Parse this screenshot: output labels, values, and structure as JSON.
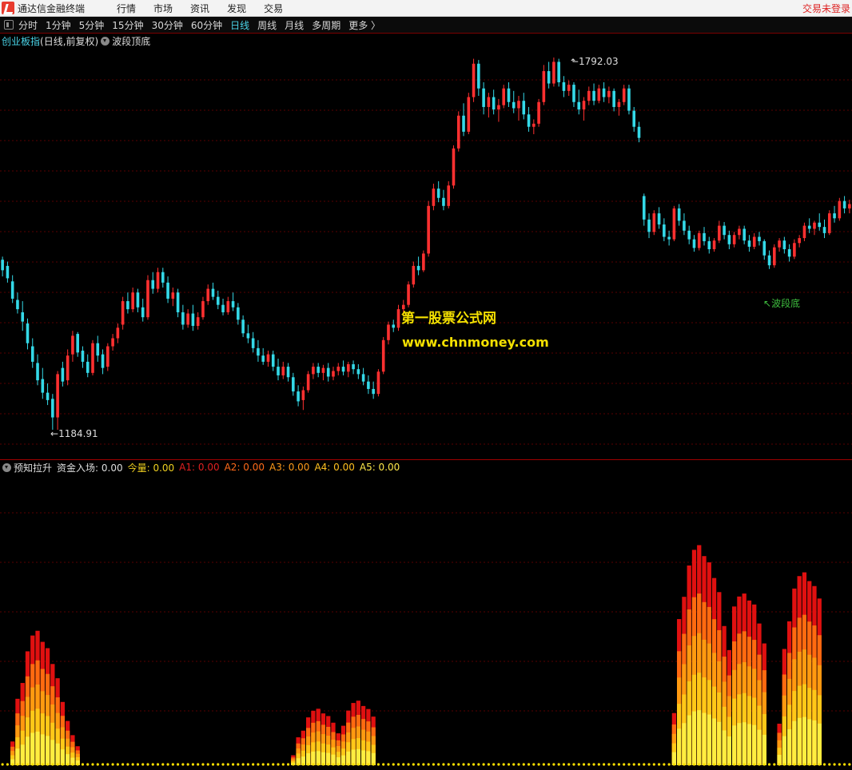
{
  "menubar": {
    "app_name": "通达信金融终端",
    "menus": [
      "行情",
      "市场",
      "资讯",
      "发现",
      "交易"
    ],
    "status": "交易未登录"
  },
  "toolbar": {
    "periods": [
      "分时",
      "1分钟",
      "5分钟",
      "15分钟",
      "30分钟",
      "60分钟",
      "日线",
      "周线",
      "月线",
      "多周期",
      "更多 〉"
    ],
    "active_period": "日线"
  },
  "main_chart": {
    "title": "创业板指",
    "title_suffix": "(日线,前复权)",
    "indicator": "波段顶底",
    "high_label": "1792.03",
    "low_label": "1184.91",
    "bottom_marker": "波段底",
    "bottom_marker_color": "#3fbf3f"
  },
  "sub_chart": {
    "indicator": "预知拉升",
    "fields": [
      {
        "label": "资金入场:",
        "value": "0.00",
        "color": "#dddddd"
      },
      {
        "label": "今量:",
        "value": "0.00",
        "color": "#f0d020"
      },
      {
        "label": "A1:",
        "value": "0.00",
        "color": "#e02020"
      },
      {
        "label": "A2:",
        "value": "0.00",
        "color": "#ff6a1a"
      },
      {
        "label": "A3:",
        "value": "0.00",
        "color": "#ff9a1a"
      },
      {
        "label": "A4:",
        "value": "0.00",
        "color": "#ffc020"
      },
      {
        "label": "A5:",
        "value": "0.00",
        "color": "#ffe84a"
      }
    ]
  },
  "watermark": {
    "line1": "第一股票公式网",
    "line2": "www.chnmoney.com"
  },
  "colors": {
    "up": "#ff3030",
    "down": "#34d9e8",
    "grid": "#5a0000",
    "bars": [
      "#e01010",
      "#ff6a10",
      "#ff9a10",
      "#ffc818",
      "#ffee40"
    ]
  },
  "chart_data": {
    "type": "candlestick",
    "title": "创业板指",
    "price_range": [
      1184.91,
      1792.03
    ],
    "ohlc": [
      [
        1465,
        1470,
        1438,
        1448
      ],
      [
        1455,
        1462,
        1428,
        1435
      ],
      [
        1430,
        1440,
        1395,
        1402
      ],
      [
        1400,
        1412,
        1378,
        1385
      ],
      [
        1380,
        1398,
        1350,
        1365
      ],
      [
        1362,
        1370,
        1320,
        1330
      ],
      [
        1325,
        1338,
        1290,
        1300
      ],
      [
        1298,
        1312,
        1262,
        1270
      ],
      [
        1272,
        1290,
        1240,
        1250
      ],
      [
        1250,
        1265,
        1230,
        1238
      ],
      [
        1240,
        1248,
        1190,
        1210
      ],
      [
        1210,
        1285,
        1190,
        1280
      ],
      [
        1290,
        1300,
        1260,
        1268
      ],
      [
        1270,
        1320,
        1262,
        1310
      ],
      [
        1312,
        1350,
        1300,
        1342
      ],
      [
        1345,
        1348,
        1308,
        1315
      ],
      [
        1318,
        1325,
        1290,
        1300
      ],
      [
        1300,
        1312,
        1275,
        1282
      ],
      [
        1282,
        1335,
        1278,
        1330
      ],
      [
        1330,
        1342,
        1300,
        1310
      ],
      [
        1312,
        1320,
        1280,
        1290
      ],
      [
        1292,
        1330,
        1285,
        1325
      ],
      [
        1325,
        1345,
        1318,
        1338
      ],
      [
        1338,
        1362,
        1330,
        1355
      ],
      [
        1360,
        1405,
        1352,
        1398
      ],
      [
        1398,
        1412,
        1378,
        1385
      ],
      [
        1385,
        1420,
        1380,
        1412
      ],
      [
        1412,
        1418,
        1380,
        1388
      ],
      [
        1388,
        1402,
        1365,
        1372
      ],
      [
        1372,
        1440,
        1368,
        1432
      ],
      [
        1432,
        1445,
        1410,
        1418
      ],
      [
        1418,
        1452,
        1412,
        1445
      ],
      [
        1445,
        1452,
        1420,
        1428
      ],
      [
        1428,
        1438,
        1395,
        1402
      ],
      [
        1402,
        1420,
        1390,
        1412
      ],
      [
        1412,
        1418,
        1372,
        1380
      ],
      [
        1380,
        1392,
        1352,
        1360
      ],
      [
        1360,
        1385,
        1355,
        1378
      ],
      [
        1378,
        1392,
        1350,
        1358
      ],
      [
        1358,
        1380,
        1352,
        1372
      ],
      [
        1372,
        1405,
        1368,
        1398
      ],
      [
        1398,
        1425,
        1392,
        1418
      ],
      [
        1418,
        1428,
        1400,
        1405
      ],
      [
        1405,
        1415,
        1385,
        1392
      ],
      [
        1392,
        1402,
        1375,
        1380
      ],
      [
        1380,
        1405,
        1376,
        1398
      ],
      [
        1398,
        1412,
        1382,
        1388
      ],
      [
        1388,
        1395,
        1360,
        1368
      ],
      [
        1368,
        1375,
        1340,
        1346
      ],
      [
        1346,
        1360,
        1330,
        1338
      ],
      [
        1338,
        1348,
        1315,
        1322
      ],
      [
        1322,
        1335,
        1300,
        1310
      ],
      [
        1310,
        1322,
        1295,
        1300
      ],
      [
        1300,
        1318,
        1292,
        1312
      ],
      [
        1312,
        1318,
        1285,
        1292
      ],
      [
        1292,
        1305,
        1270,
        1278
      ],
      [
        1278,
        1300,
        1272,
        1292
      ],
      [
        1292,
        1298,
        1268,
        1275
      ],
      [
        1275,
        1282,
        1245,
        1252
      ],
      [
        1252,
        1262,
        1228,
        1236
      ],
      [
        1238,
        1260,
        1222,
        1254
      ],
      [
        1254,
        1285,
        1250,
        1280
      ],
      [
        1280,
        1298,
        1272,
        1292
      ],
      [
        1292,
        1298,
        1275,
        1282
      ],
      [
        1282,
        1295,
        1270,
        1290
      ],
      [
        1290,
        1298,
        1268,
        1276
      ],
      [
        1276,
        1292,
        1270,
        1285
      ],
      [
        1285,
        1298,
        1278,
        1292
      ],
      [
        1292,
        1302,
        1278,
        1284
      ],
      [
        1284,
        1300,
        1275,
        1296
      ],
      [
        1296,
        1302,
        1280,
        1288
      ],
      [
        1288,
        1296,
        1272,
        1280
      ],
      [
        1280,
        1290,
        1262,
        1268
      ],
      [
        1268,
        1278,
        1248,
        1256
      ],
      [
        1256,
        1268,
        1240,
        1248
      ],
      [
        1248,
        1288,
        1244,
        1284
      ],
      [
        1284,
        1340,
        1280,
        1335
      ],
      [
        1335,
        1365,
        1328,
        1360
      ],
      [
        1360,
        1368,
        1348,
        1355
      ],
      [
        1355,
        1392,
        1350,
        1385
      ],
      [
        1385,
        1400,
        1375,
        1392
      ],
      [
        1392,
        1430,
        1388,
        1425
      ],
      [
        1425,
        1462,
        1420,
        1455
      ],
      [
        1455,
        1470,
        1440,
        1448
      ],
      [
        1448,
        1480,
        1445,
        1475
      ],
      [
        1475,
        1560,
        1470,
        1552
      ],
      [
        1552,
        1588,
        1545,
        1580
      ],
      [
        1580,
        1592,
        1558,
        1565
      ],
      [
        1565,
        1578,
        1545,
        1552
      ],
      [
        1552,
        1592,
        1548,
        1585
      ],
      [
        1585,
        1650,
        1580,
        1645
      ],
      [
        1645,
        1705,
        1640,
        1698
      ],
      [
        1698,
        1718,
        1665,
        1672
      ],
      [
        1672,
        1735,
        1668,
        1728
      ],
      [
        1728,
        1790,
        1720,
        1782
      ],
      [
        1782,
        1788,
        1730,
        1742
      ],
      [
        1742,
        1752,
        1700,
        1712
      ],
      [
        1712,
        1735,
        1695,
        1728
      ],
      [
        1728,
        1740,
        1700,
        1708
      ],
      [
        1708,
        1725,
        1688,
        1715
      ],
      [
        1715,
        1748,
        1710,
        1742
      ],
      [
        1742,
        1752,
        1712,
        1720
      ],
      [
        1720,
        1738,
        1702,
        1710
      ],
      [
        1710,
        1730,
        1690,
        1722
      ],
      [
        1722,
        1735,
        1692,
        1700
      ],
      [
        1700,
        1712,
        1672,
        1680
      ],
      [
        1680,
        1692,
        1668,
        1685
      ],
      [
        1685,
        1725,
        1680,
        1720
      ],
      [
        1720,
        1780,
        1715,
        1770
      ],
      [
        1770,
        1785,
        1742,
        1750
      ],
      [
        1750,
        1792,
        1745,
        1785
      ],
      [
        1785,
        1790,
        1745,
        1752
      ],
      [
        1752,
        1762,
        1728,
        1738
      ],
      [
        1738,
        1755,
        1730,
        1748
      ],
      [
        1748,
        1752,
        1712,
        1720
      ],
      [
        1720,
        1740,
        1700,
        1708
      ],
      [
        1708,
        1728,
        1690,
        1722
      ],
      [
        1722,
        1745,
        1715,
        1738
      ],
      [
        1738,
        1750,
        1715,
        1722
      ],
      [
        1722,
        1748,
        1718,
        1742
      ],
      [
        1742,
        1752,
        1720,
        1728
      ],
      [
        1728,
        1745,
        1718,
        1738
      ],
      [
        1738,
        1742,
        1705,
        1712
      ],
      [
        1712,
        1725,
        1698,
        1720
      ],
      [
        1720,
        1748,
        1715,
        1742
      ],
      [
        1742,
        1748,
        1700,
        1706
      ],
      [
        1706,
        1712,
        1672,
        1680
      ],
      [
        1680,
        1688,
        1655,
        1662
      ],
      [
        1568,
        1572,
        1520,
        1530
      ],
      [
        1530,
        1540,
        1500,
        1510
      ],
      [
        1510,
        1545,
        1505,
        1540
      ],
      [
        1540,
        1550,
        1515,
        1522
      ],
      [
        1522,
        1532,
        1495,
        1502
      ],
      [
        1502,
        1512,
        1488,
        1498
      ],
      [
        1498,
        1552,
        1495,
        1548
      ],
      [
        1548,
        1555,
        1520,
        1528
      ],
      [
        1528,
        1540,
        1505,
        1512
      ],
      [
        1512,
        1520,
        1490,
        1498
      ],
      [
        1498,
        1505,
        1478,
        1484
      ],
      [
        1484,
        1512,
        1480,
        1508
      ],
      [
        1508,
        1518,
        1488,
        1495
      ],
      [
        1495,
        1502,
        1475,
        1482
      ],
      [
        1482,
        1500,
        1478,
        1496
      ],
      [
        1496,
        1528,
        1492,
        1520
      ],
      [
        1520,
        1526,
        1498,
        1505
      ],
      [
        1505,
        1512,
        1482,
        1490
      ],
      [
        1490,
        1510,
        1485,
        1505
      ],
      [
        1505,
        1520,
        1498,
        1515
      ],
      [
        1515,
        1520,
        1490,
        1496
      ],
      [
        1496,
        1505,
        1478,
        1486
      ],
      [
        1486,
        1508,
        1482,
        1502
      ],
      [
        1502,
        1510,
        1488,
        1495
      ],
      [
        1495,
        1498,
        1465,
        1472
      ],
      [
        1472,
        1480,
        1450,
        1456
      ],
      [
        1456,
        1490,
        1452,
        1485
      ],
      [
        1485,
        1500,
        1478,
        1496
      ],
      [
        1496,
        1502,
        1475,
        1482
      ],
      [
        1482,
        1490,
        1462,
        1470
      ],
      [
        1470,
        1498,
        1466,
        1492
      ],
      [
        1492,
        1505,
        1485,
        1500
      ],
      [
        1500,
        1525,
        1495,
        1520
      ],
      [
        1520,
        1532,
        1508,
        1515
      ],
      [
        1515,
        1528,
        1505,
        1525
      ],
      [
        1525,
        1540,
        1512,
        1518
      ],
      [
        1518,
        1530,
        1500,
        1508
      ],
      [
        1508,
        1545,
        1505,
        1540
      ],
      [
        1540,
        1552,
        1525,
        1532
      ],
      [
        1532,
        1565,
        1528,
        1560
      ],
      [
        1560,
        1568,
        1540,
        1548
      ],
      [
        1548,
        1562,
        1540,
        1555
      ]
    ],
    "sub_values": [
      [
        0.05,
        0.08,
        0.1,
        0.12,
        0.15
      ],
      [
        0.12,
        0.18,
        0.24,
        0.32,
        0.42
      ],
      [
        0.18,
        0.26,
        0.32,
        0.4,
        0.52
      ],
      [
        0.3,
        0.4,
        0.48,
        0.6,
        0.72
      ],
      [
        0.4,
        0.5,
        0.6,
        0.7,
        0.82
      ],
      [
        0.45,
        0.55,
        0.65,
        0.72,
        0.85
      ],
      [
        0.42,
        0.52,
        0.62,
        0.7,
        0.78
      ],
      [
        0.38,
        0.48,
        0.58,
        0.66,
        0.74
      ],
      [
        0.28,
        0.38,
        0.48,
        0.56,
        0.64
      ],
      [
        0.2,
        0.3,
        0.38,
        0.45,
        0.55
      ],
      [
        0.15,
        0.22,
        0.28,
        0.34,
        0.4
      ],
      [
        0.1,
        0.14,
        0.18,
        0.22,
        0.28
      ],
      [
        0.06,
        0.09,
        0.12,
        0.15,
        0.19
      ],
      [
        0.04,
        0.06,
        0.08,
        0.1,
        0.12
      ],
      [
        0.03,
        0.04,
        0.05,
        0.06,
        0.08
      ],
      [
        0.02,
        0.03,
        0.04,
        0.05,
        0.06
      ]
    ]
  }
}
